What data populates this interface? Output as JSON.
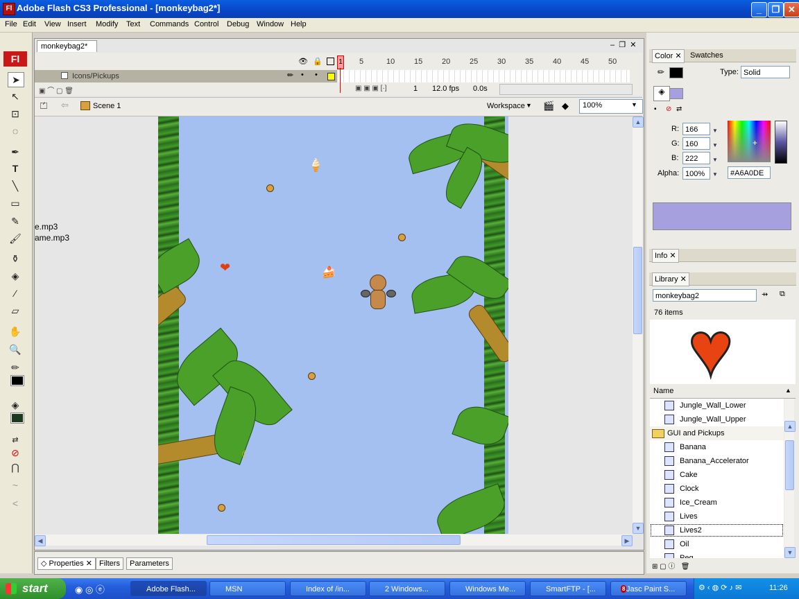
{
  "window": {
    "title": "Adobe Flash CS3 Professional - [monkeybag2*]",
    "app_icon": "Fl"
  },
  "menu": [
    "File",
    "Edit",
    "View",
    "Insert",
    "Modify",
    "Text",
    "Commands",
    "Control",
    "Debug",
    "Window",
    "Help"
  ],
  "toolbox": {
    "logo": "Fl"
  },
  "document": {
    "tab": "monkeybag2*"
  },
  "timeline": {
    "frame_numbers": [
      "1",
      "5",
      "10",
      "15",
      "20",
      "25",
      "30",
      "35",
      "40",
      "45",
      "50"
    ],
    "layer_name": "Icons/Pickups",
    "current_frame": "1",
    "frame_rate": "12.0 fps",
    "elapsed": "0.0s"
  },
  "scene": {
    "name": "Scene 1",
    "workspace": "Workspace",
    "zoom": "100%"
  },
  "stage": {
    "text_lines": [
      "e.mp3",
      "ame.mp3"
    ]
  },
  "properties": {
    "tabs": [
      "Properties",
      "Filters",
      "Parameters"
    ]
  },
  "color_panel": {
    "tabs": [
      "Color",
      "Swatches"
    ],
    "type_label": "Type:",
    "type_value": "Solid",
    "r_label": "R:",
    "r": "166",
    "g_label": "G:",
    "g": "160",
    "b_label": "B:",
    "b": "222",
    "alpha_label": "Alpha:",
    "alpha": "100%",
    "hex": "#A6A0DE",
    "swatch_color": "#a6a0de"
  },
  "info_panel": {
    "tab": "Info"
  },
  "library": {
    "tab": "Library",
    "document": "monkeybag2",
    "count": "76 items",
    "column": "Name",
    "items": [
      {
        "name": "Jungle_Wall_Lower",
        "type": "symbol"
      },
      {
        "name": "Jungle_Wall_Upper",
        "type": "symbol"
      },
      {
        "name": "GUI and Pickups",
        "type": "folder"
      },
      {
        "name": "Banana",
        "type": "symbol"
      },
      {
        "name": "Banana_Accelerator",
        "type": "symbol"
      },
      {
        "name": "Cake",
        "type": "symbol"
      },
      {
        "name": "Clock",
        "type": "symbol"
      },
      {
        "name": "Ice_Cream",
        "type": "symbol"
      },
      {
        "name": "Lives",
        "type": "symbol"
      },
      {
        "name": "Lives2",
        "type": "symbol",
        "selected": true
      },
      {
        "name": "Oil",
        "type": "symbol"
      },
      {
        "name": "Peg",
        "type": "symbol"
      }
    ]
  },
  "taskbar": {
    "start": "start",
    "buttons": [
      "Adobe Flash...",
      "MSN",
      "Index of /in...",
      "2 Windows...",
      "Windows Me...",
      "SmartFTP - [...",
      "Jasc Paint S..."
    ],
    "jasc_badge": "8",
    "clock": "11:26"
  }
}
